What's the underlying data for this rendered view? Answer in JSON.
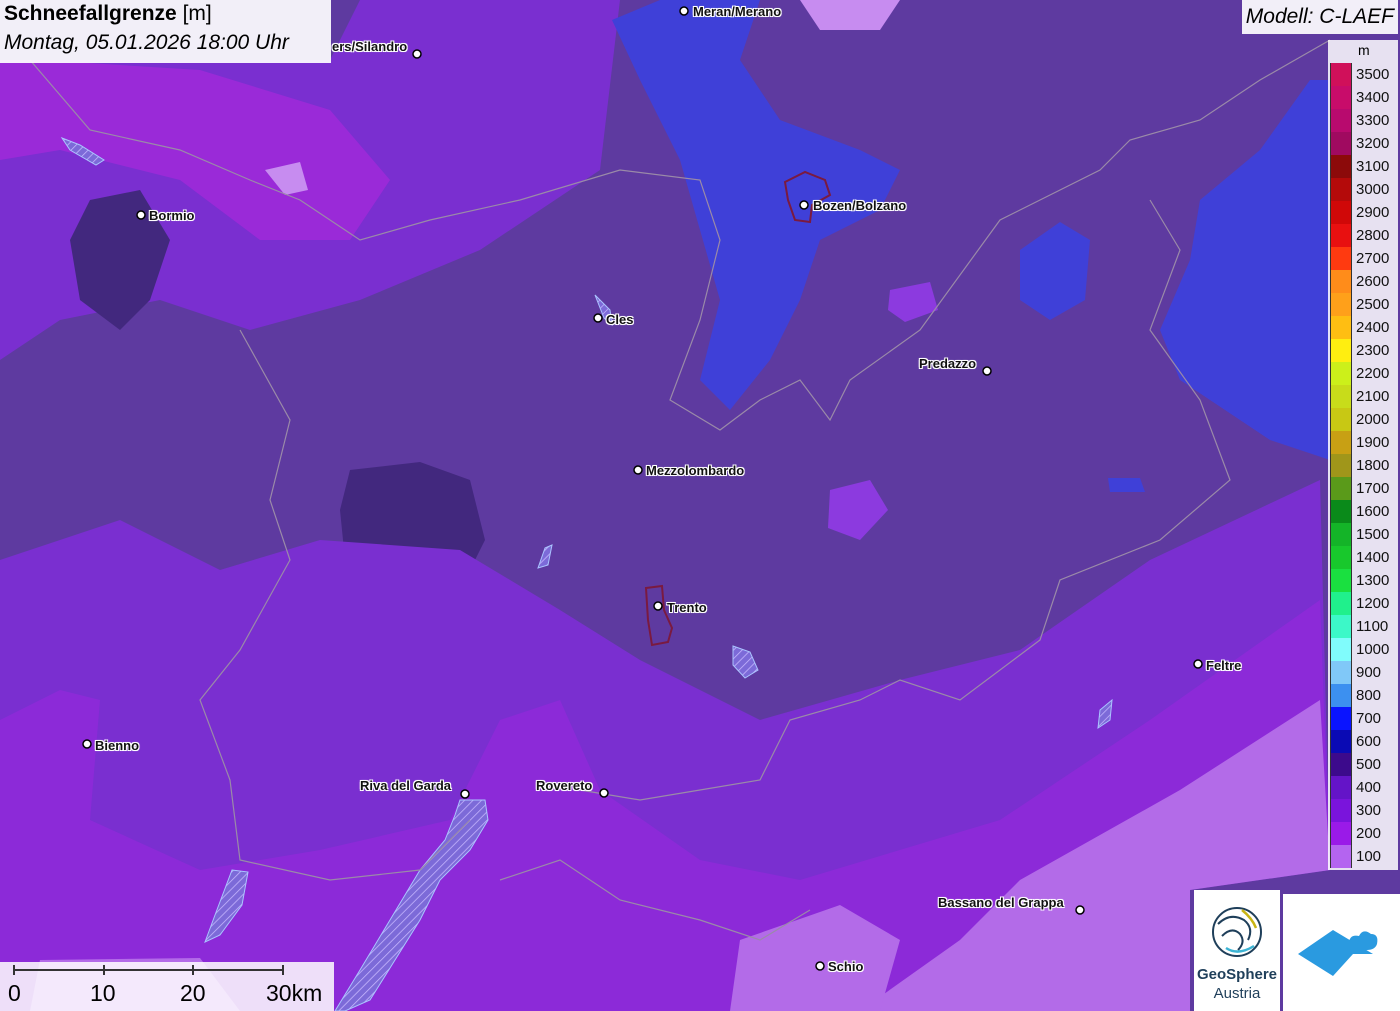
{
  "title": {
    "parameter": "Schneefallgrenze",
    "unit": "[m]",
    "datetime": "Montag, 05.01.2026 18:00 Uhr"
  },
  "model": "Modell: C-LAEF",
  "legend": {
    "unit": "m",
    "entries": [
      {
        "value": "3500",
        "color": "#d0105a"
      },
      {
        "value": "3400",
        "color": "#c80c6a"
      },
      {
        "value": "3300",
        "color": "#b80a6e"
      },
      {
        "value": "3200",
        "color": "#a00a60"
      },
      {
        "value": "3100",
        "color": "#8c0a0a"
      },
      {
        "value": "3000",
        "color": "#b40a0a"
      },
      {
        "value": "2900",
        "color": "#d00808"
      },
      {
        "value": "2800",
        "color": "#e81010"
      },
      {
        "value": "2700",
        "color": "#ff3a10"
      },
      {
        "value": "2600",
        "color": "#ff8c1a"
      },
      {
        "value": "2500",
        "color": "#ffa01a"
      },
      {
        "value": "2400",
        "color": "#ffbe12"
      },
      {
        "value": "2300",
        "color": "#ffee10"
      },
      {
        "value": "2200",
        "color": "#ccf01a"
      },
      {
        "value": "2100",
        "color": "#c8dc1a"
      },
      {
        "value": "2000",
        "color": "#c8c814"
      },
      {
        "value": "1900",
        "color": "#c8a014"
      },
      {
        "value": "1800",
        "color": "#a0961a"
      },
      {
        "value": "1700",
        "color": "#5a9a1a"
      },
      {
        "value": "1600",
        "color": "#0a8a1a"
      },
      {
        "value": "1500",
        "color": "#14b428"
      },
      {
        "value": "1400",
        "color": "#18c82c"
      },
      {
        "value": "1300",
        "color": "#1ae040"
      },
      {
        "value": "1200",
        "color": "#20f08c"
      },
      {
        "value": "1100",
        "color": "#3cf8c8"
      },
      {
        "value": "1000",
        "color": "#80fcfc"
      },
      {
        "value": "900",
        "color": "#80c8f8"
      },
      {
        "value": "800",
        "color": "#3c90f0"
      },
      {
        "value": "700",
        "color": "#0a14ff"
      },
      {
        "value": "600",
        "color": "#0a0ab4"
      },
      {
        "value": "500",
        "color": "#3c0a8c"
      },
      {
        "value": "400",
        "color": "#6414c8"
      },
      {
        "value": "300",
        "color": "#7a14dc"
      },
      {
        "value": "200",
        "color": "#9a1ae8"
      },
      {
        "value": "100",
        "color": "#b464f0"
      }
    ]
  },
  "cities": [
    {
      "name": "Meran/Merano"
    },
    {
      "name": "ers/Silandro"
    },
    {
      "name": "Bormio"
    },
    {
      "name": "Bozen/Bolzano"
    },
    {
      "name": "Cles"
    },
    {
      "name": "Predazzo"
    },
    {
      "name": "Mezzolombardo"
    },
    {
      "name": "Trento"
    },
    {
      "name": "Feltre"
    },
    {
      "name": "Bienno"
    },
    {
      "name": "Riva del Garda"
    },
    {
      "name": "Rovereto"
    },
    {
      "name": "Bassano del Grappa"
    },
    {
      "name": "Schio"
    }
  ],
  "scalebar": {
    "ticks": [
      "0",
      "10",
      "20",
      "30km"
    ]
  },
  "logo": {
    "name": "GeoSphere",
    "sub": "Austria"
  }
}
